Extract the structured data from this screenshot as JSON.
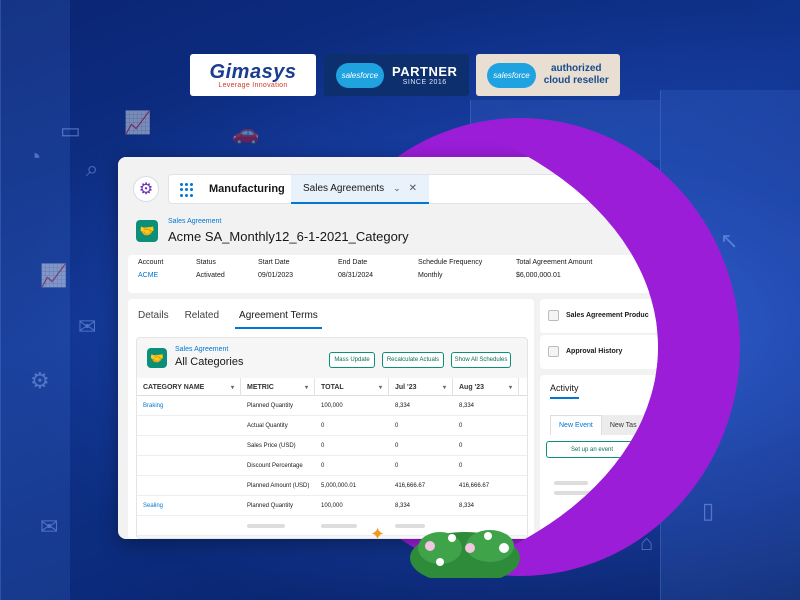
{
  "logos": {
    "gimasys_word": "Gimasys",
    "gimasys_tag": "Leverage Innovation",
    "partner_cloud": "salesforce",
    "partner_title": "PARTNER",
    "partner_since": "SINCE 2016",
    "reseller_cloud": "salesforce",
    "reseller_text_1": "authorized",
    "reseller_text_2": "cloud reseller"
  },
  "nav": {
    "app_name": "Manufacturing",
    "tab_label": "Sales Agreements"
  },
  "record": {
    "type": "Sales Agreement",
    "title": "Acme SA_Monthly12_6-1-2021_Category",
    "highlights": [
      {
        "label": "Account",
        "value": "ACME"
      },
      {
        "label": "Status",
        "value": "Activated"
      },
      {
        "label": "Start Date",
        "value": "09/01/2023"
      },
      {
        "label": "End Date",
        "value": "08/31/2024"
      },
      {
        "label": "Schedule Frequency",
        "value": "Monthly"
      },
      {
        "label": "Total Agreement Amount",
        "value": "$6,000,000.01"
      }
    ]
  },
  "tabs": [
    "Details",
    "Related",
    "Agreement Terms"
  ],
  "inner": {
    "type": "Sales Agreement",
    "title": "All Categories",
    "buttons": [
      "Mass Update",
      "Recalculate Actuals",
      "Show All Schedules"
    ]
  },
  "table": {
    "headers": [
      "CATEGORY NAME",
      "METRIC",
      "TOTAL",
      "Jul '23",
      "Aug '23"
    ],
    "rows": [
      [
        "Braking",
        "Planned Quantity",
        "100,000",
        "8,334",
        "8,334"
      ],
      [
        "",
        "Actual Quantity",
        "0",
        "0",
        "0"
      ],
      [
        "",
        "Sales Price (USD)",
        "0",
        "0",
        "0"
      ],
      [
        "",
        "Discount Percentage",
        "0",
        "0",
        "0"
      ],
      [
        "",
        "Planned Amount (USD)",
        "5,000,000.01",
        "416,666.67",
        "416,666.67"
      ],
      [
        "Sealing",
        "Planned Quantity",
        "100,000",
        "8,334",
        "8,334"
      ]
    ]
  },
  "side": {
    "products_title": "Sales Agreement Produc",
    "history_title": "Approval History",
    "activity_title": "Activity",
    "new_event": "New Event",
    "new_task": "New Tas",
    "setup_button": "Set up an event"
  }
}
